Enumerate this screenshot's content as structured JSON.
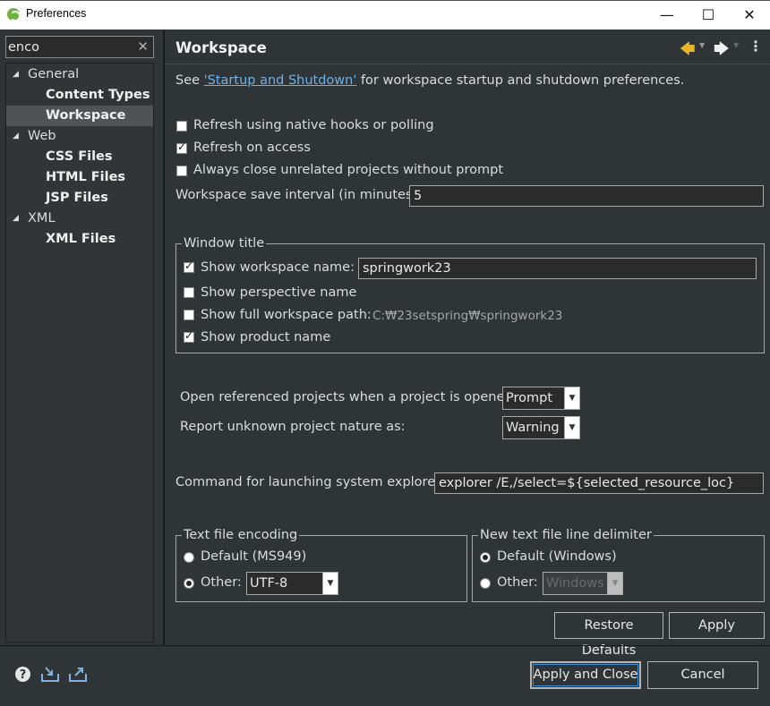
{
  "window": {
    "title": "Preferences",
    "minimize_icon": "—",
    "maximize_icon": "☐",
    "close_icon": "✕"
  },
  "filter": {
    "value": "enco",
    "clear_icon": "✕"
  },
  "tree": {
    "items": [
      {
        "label": "General",
        "arrow": "◢",
        "level": 0
      },
      {
        "label": "Content Types",
        "level": 1
      },
      {
        "label": "Workspace",
        "level": 1,
        "selected": true
      },
      {
        "label": "Web",
        "arrow": "◢",
        "level": 0
      },
      {
        "label": "CSS Files",
        "level": 1
      },
      {
        "label": "HTML Files",
        "level": 1
      },
      {
        "label": "JSP Files",
        "level": 1
      },
      {
        "label": "XML",
        "arrow": "◢",
        "level": 0
      },
      {
        "label": "XML Files",
        "level": 1
      }
    ]
  },
  "page": {
    "title": "Workspace",
    "nav_back": "🡄",
    "nav_forward": "🡆",
    "menu_arrow": "▼",
    "view_menu": "⋮",
    "intro_prefix": "See ",
    "intro_link": "'Startup and Shutdown'",
    "intro_suffix": " for workspace startup and shutdown preferences.",
    "refresh_native": "Refresh using native hooks or polling",
    "refresh_access": "Refresh on access",
    "always_close": "Always close unrelated projects without prompt",
    "save_interval_label": "Workspace save interval (in minutes):",
    "save_interval_value": "5",
    "window_title_group": "Window title",
    "show_workspace_name": "Show workspace name:",
    "workspace_name_value": "springwork23",
    "show_perspective_name": "Show perspective name",
    "show_full_path": "Show full workspace path:",
    "full_path_value": "C:₩23setspring₩springwork23",
    "show_product_name": "Show product name",
    "open_referenced_label": "Open referenced projects when a project is opened:",
    "open_referenced_value": "Prompt",
    "report_nature_label": "Report unknown project nature as:",
    "report_nature_value": "Warning",
    "explorer_label": "Command for launching system explorer:",
    "explorer_value": "explorer /E,/select=${selected_resource_loc}",
    "encoding_group": "Text file encoding",
    "encoding_default": "Default (MS949)",
    "encoding_other": "Other:",
    "encoding_other_value": "UTF-8",
    "delimiter_group": "New text file line delimiter",
    "delimiter_default": "Default (Windows)",
    "delimiter_other": "Other:",
    "delimiter_other_value": "Windows",
    "combo_arrow": "▼",
    "restore_defaults": "Restore Defaults",
    "apply": "Apply"
  },
  "footer": {
    "help_icon": "?",
    "apply_and_close": "Apply and Close",
    "cancel": "Cancel"
  }
}
